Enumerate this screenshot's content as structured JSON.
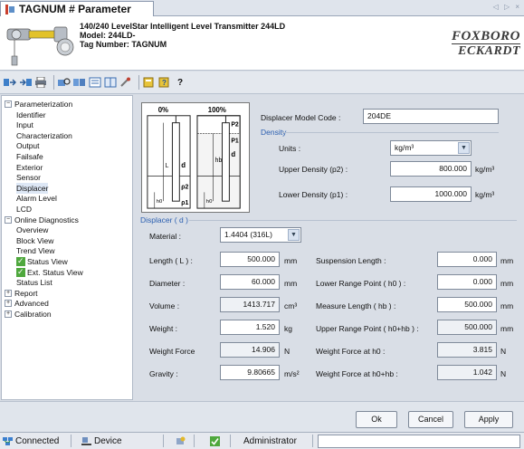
{
  "tab": {
    "title": "TAGNUM # Parameter",
    "nav": "◁ ▷ ×"
  },
  "header": {
    "line1": "140/240 LevelStar Intelligent Level Transmitter 244LD",
    "line2": "Model: 244LD-",
    "line3": "Tag Number: TAGNUM",
    "brand_top": "FOXBORO",
    "brand_bottom": "ECKARDT"
  },
  "toolbar": {
    "help_label": "?"
  },
  "tree": [
    {
      "label": "Parameterization",
      "expander": "−",
      "level": 0
    },
    {
      "label": "Identifier",
      "level": 1
    },
    {
      "label": "Input",
      "level": 1
    },
    {
      "label": "Characterization",
      "level": 1
    },
    {
      "label": "Output",
      "level": 1
    },
    {
      "label": "Failsafe",
      "level": 1
    },
    {
      "label": "Exterior",
      "level": 1
    },
    {
      "label": "Sensor",
      "level": 1
    },
    {
      "label": "Displacer",
      "level": 1,
      "selected": true
    },
    {
      "label": "Alarm Level",
      "level": 1
    },
    {
      "label": "LCD",
      "level": 1
    },
    {
      "label": "Online Diagnostics",
      "expander": "−",
      "level": 0
    },
    {
      "label": "Overview",
      "level": 1
    },
    {
      "label": "Block View",
      "level": 1
    },
    {
      "label": "Trend View",
      "level": 1
    },
    {
      "label": "Status View",
      "level": 2,
      "check": true
    },
    {
      "label": "Ext. Status View",
      "level": 2,
      "check": true
    },
    {
      "label": "Status List",
      "level": 1
    },
    {
      "label": "Report",
      "expander": "+",
      "level": 0
    },
    {
      "label": "Advanced",
      "expander": "+",
      "level": 0
    },
    {
      "label": "Calibration",
      "expander": "+",
      "level": 0
    }
  ],
  "diagram": {
    "pct_left": "0%",
    "pct_right": "100%",
    "p2": "P2",
    "p1": "P1",
    "rho2": "ρ2",
    "rho1": "ρ1",
    "d_left": "d",
    "d_right": "d",
    "L": "L",
    "hb": "hb",
    "h0_left": "h0",
    "h0_right": "h0"
  },
  "model_code": {
    "label": "Displacer Model Code :",
    "value": "204DE"
  },
  "density": {
    "group": "Density",
    "units_label": "Units :",
    "units_value": "kg/m³",
    "upper_label": "Upper Density (p2) :",
    "upper_value": "800.000",
    "upper_unit": "kg/m³",
    "lower_label": "Lower Density (p1) :",
    "lower_value": "1000.000",
    "lower_unit": "kg/m³"
  },
  "displacer": {
    "group": "Displacer ( d )",
    "material_label": "Material :",
    "material_value": "1.4404 (316L)",
    "length_label": "Length ( L ) :",
    "length_value": "500.000",
    "length_unit": "mm",
    "diameter_label": "Diameter :",
    "diameter_value": "60.000",
    "diameter_unit": "mm",
    "volume_label": "Volume :",
    "volume_value": "1413.717",
    "volume_unit": "cm³",
    "weight_label": "Weight :",
    "weight_value": "1.520",
    "weight_unit": "kg",
    "wforce_label": "Weight Force",
    "wforce_value": "14.906",
    "wforce_unit": "N",
    "gravity_label": "Gravity :",
    "gravity_value": "9.80665",
    "gravity_unit": "m/s²",
    "susp_label": "Suspension Length :",
    "susp_value": "0.000",
    "susp_unit": "mm",
    "lrp_label": "Lower Range Point ( h0 ) :",
    "lrp_value": "0.000",
    "lrp_unit": "mm",
    "meas_label": "Measure Length ( hb ) :",
    "meas_value": "500.000",
    "meas_unit": "mm",
    "urp_label": "Upper Range Point ( h0+hb ) :",
    "urp_value": "500.000",
    "urp_unit": "mm",
    "wf0_label": "Weight Force at h0 :",
    "wf0_value": "3.815",
    "wf0_unit": "N",
    "wfb_label": "Weight Force at h0+hb :",
    "wfb_value": "1.042",
    "wfb_unit": "N"
  },
  "buttons": {
    "ok": "Ok",
    "cancel": "Cancel",
    "apply": "Apply"
  },
  "status": {
    "connected": "Connected",
    "device": "Device",
    "user": "Administrator"
  }
}
